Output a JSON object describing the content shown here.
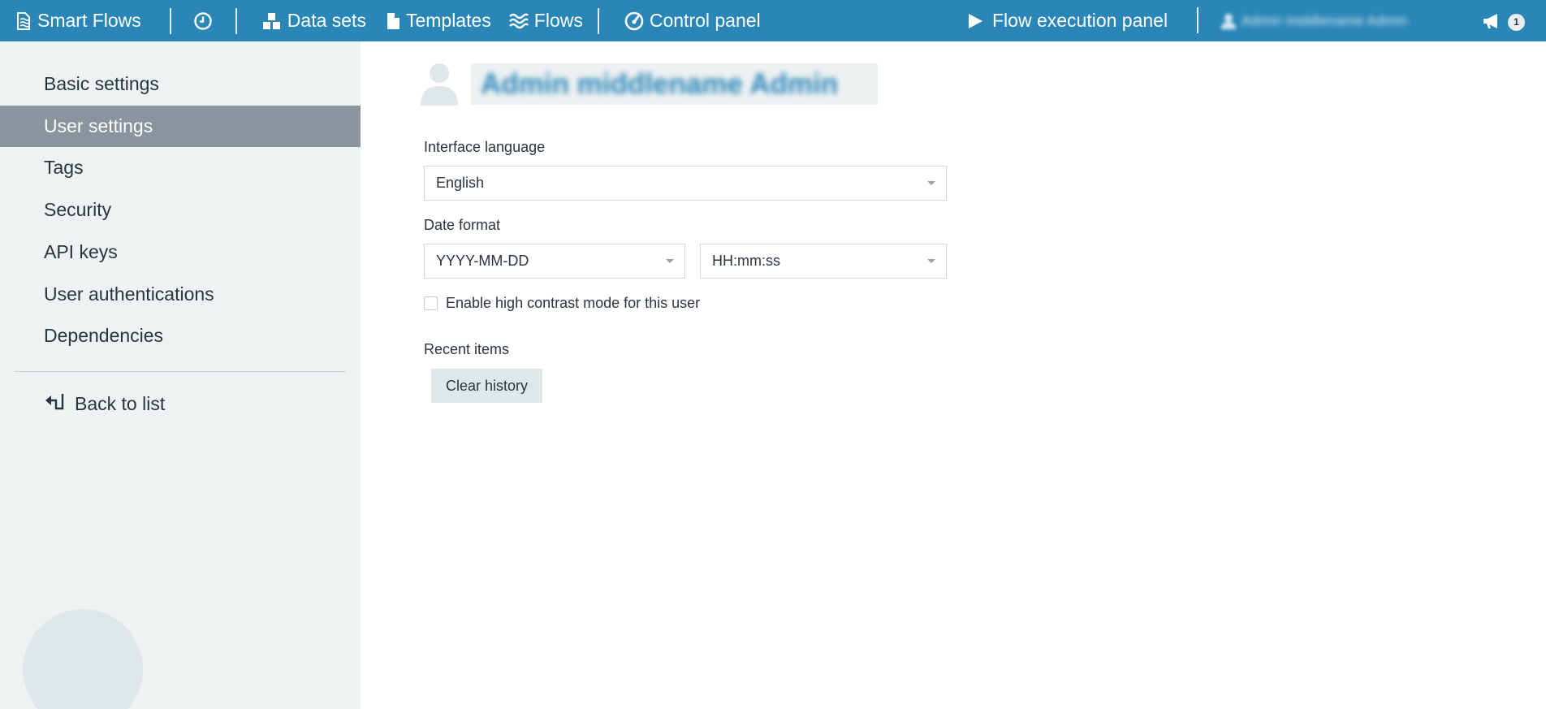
{
  "topnav": {
    "brand_label": "Smart Flows",
    "history_icon": "clock-icon",
    "items": [
      {
        "label": "Data sets",
        "icon": "cubes-icon"
      },
      {
        "label": "Templates",
        "icon": "file-icon"
      },
      {
        "label": "Flows",
        "icon": "waves-icon"
      },
      {
        "label": "Control panel",
        "icon": "gauge-icon"
      }
    ],
    "execution_panel_label": "Flow execution panel",
    "user_label": "Admin middlename Admin",
    "notification_count": "1"
  },
  "sidebar": {
    "items": [
      {
        "label": "Basic settings",
        "active": false
      },
      {
        "label": "User settings",
        "active": true
      },
      {
        "label": "Tags",
        "active": false
      },
      {
        "label": "Security",
        "active": false
      },
      {
        "label": "API keys",
        "active": false
      },
      {
        "label": "User authentications",
        "active": false
      },
      {
        "label": "Dependencies",
        "active": false
      }
    ],
    "back_label": "Back to list"
  },
  "main": {
    "user_name": "Admin middlename Admin",
    "interface_language": {
      "label": "Interface language",
      "value": "English"
    },
    "date_format": {
      "label": "Date format",
      "date_value": "YYYY-MM-DD",
      "time_value": "HH:mm:ss"
    },
    "high_contrast": {
      "label": "Enable high contrast mode for this user",
      "checked": false
    },
    "recent_items": {
      "label": "Recent items",
      "clear_button": "Clear history"
    }
  },
  "colors": {
    "topbar": "#2b86b8",
    "sidebar_bg": "#edf3f3",
    "sidebar_active": "#8a949e",
    "button_bg": "#dfe8e9"
  }
}
